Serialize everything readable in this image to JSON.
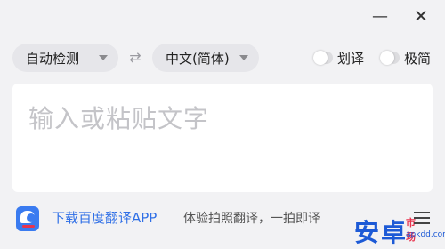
{
  "window": {
    "minimize_glyph": "—",
    "close_glyph": "✕"
  },
  "toolbar": {
    "source_language": "自动检测",
    "target_language": "中文(简体)",
    "swap_icon": "swap-icon",
    "toggles": [
      {
        "label": "划译",
        "on": false
      },
      {
        "label": "极简",
        "on": false
      }
    ]
  },
  "input": {
    "placeholder": "输入或粘贴文字"
  },
  "footer": {
    "download_link": "下载百度翻译APP",
    "promo_text": "体验拍照翻译，一拍即译",
    "menu_icon": "hamburger-menu-icon"
  },
  "watermark": {
    "main": "安卓",
    "sub": "市场",
    "domain": "apkdd.com"
  },
  "colors": {
    "link": "#2f6fe6",
    "placeholder": "#c4c4c8",
    "background": "#f2f2f4"
  }
}
